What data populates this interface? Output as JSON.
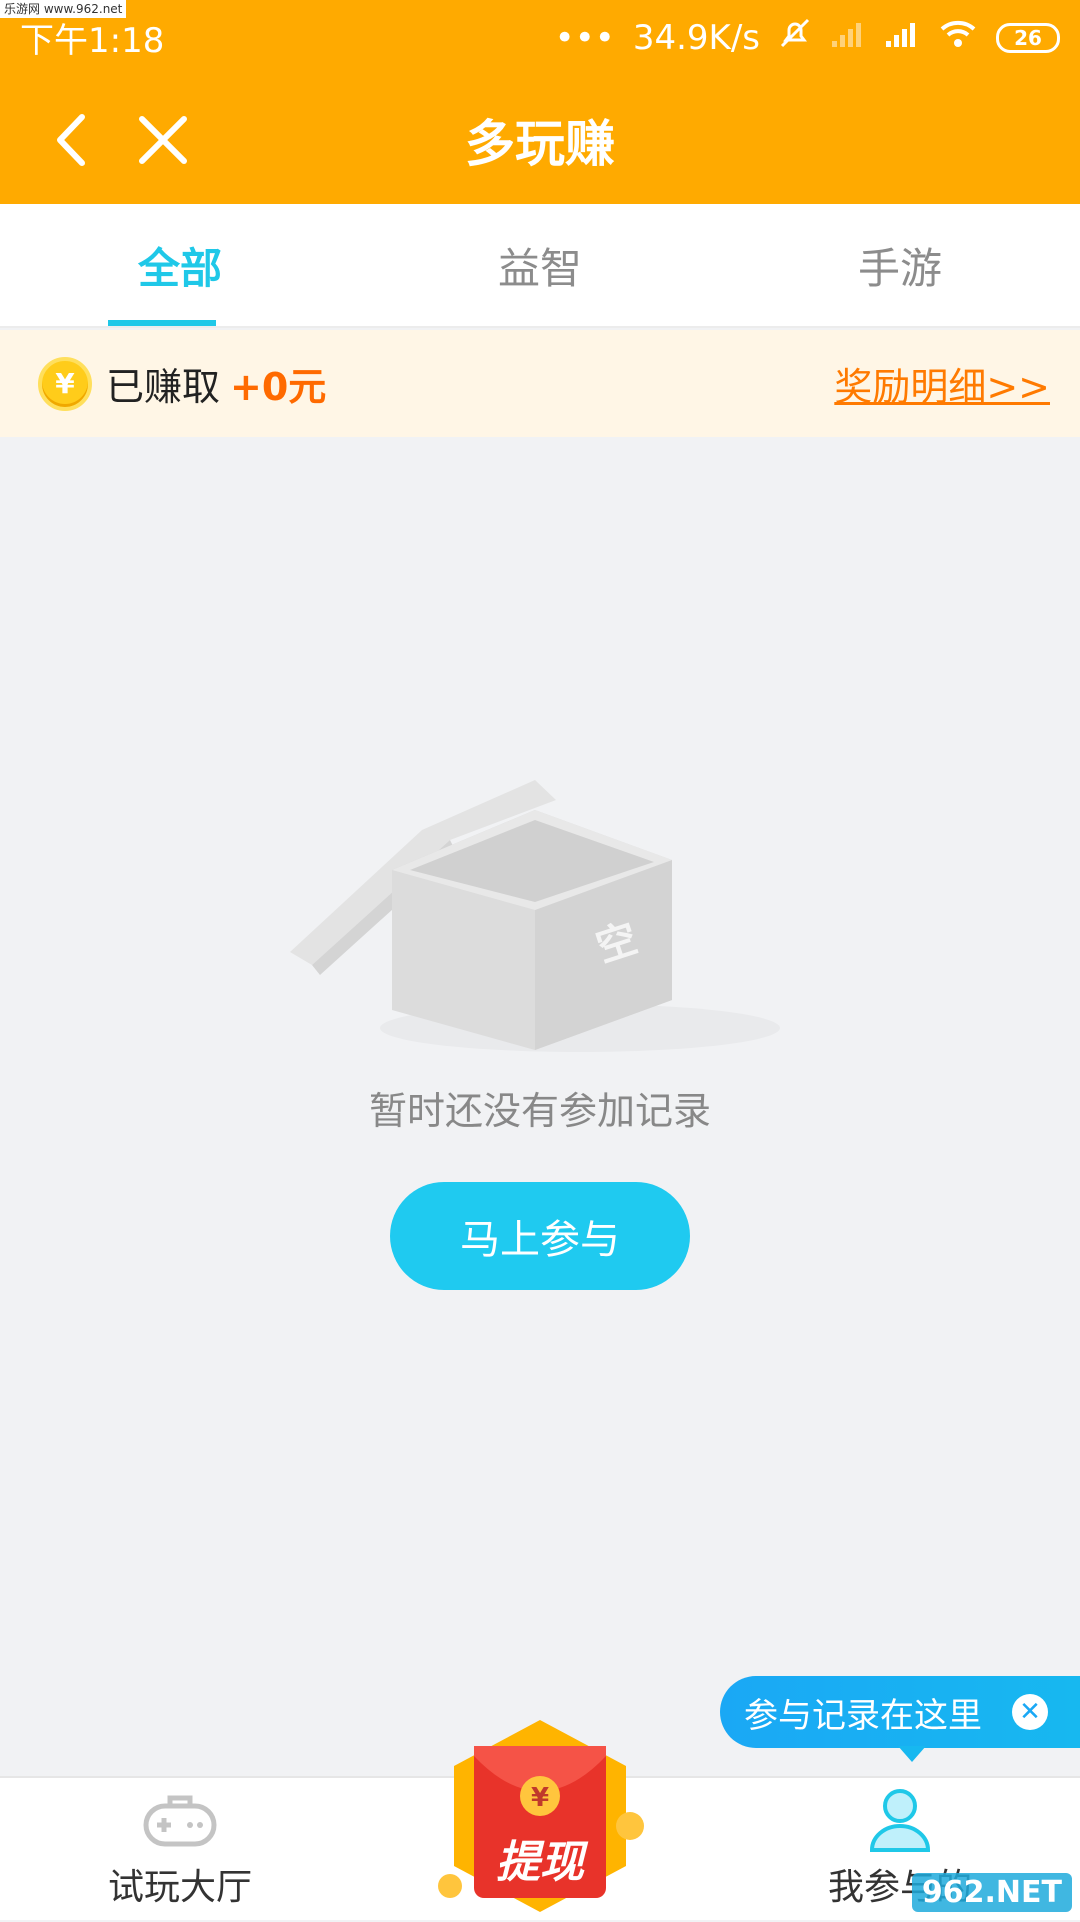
{
  "status_bar": {
    "time": "下午1:18",
    "speed": "34.9K/s",
    "battery": "26",
    "watermark": "乐游网 www.962.net"
  },
  "header": {
    "title": "多玩赚"
  },
  "tabs": [
    {
      "label": "全部",
      "active": true
    },
    {
      "label": "益智",
      "active": false
    },
    {
      "label": "手游",
      "active": false
    }
  ],
  "earnings": {
    "label": "已赚取",
    "amount": "+0元",
    "detail_link": "奖励明细>>"
  },
  "empty_state": {
    "box_text": "空",
    "message": "暂时还没有参加记录",
    "button": "马上参与"
  },
  "tooltip": {
    "text": "参与记录在这里"
  },
  "bottom_nav": {
    "left_label": "试玩大厅",
    "center_label": "提现",
    "right_label": "我参与的"
  },
  "watermark_br": "962.NET"
}
